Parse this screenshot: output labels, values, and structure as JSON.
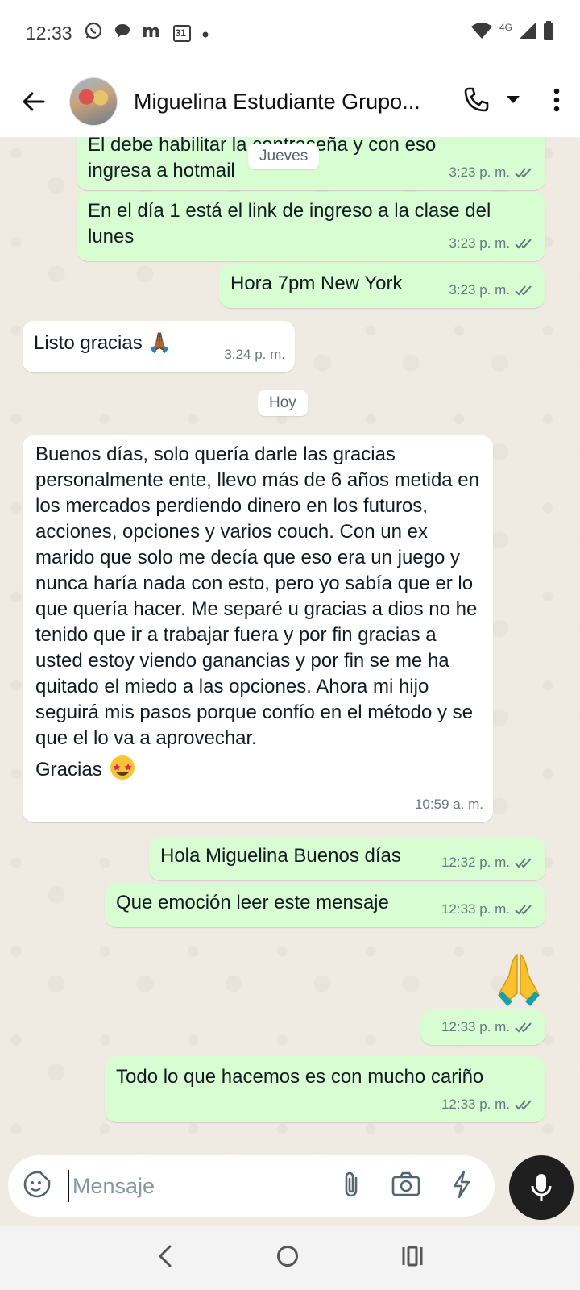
{
  "status_bar": {
    "time": "12:33",
    "network": "4G",
    "icons": [
      "whatsapp-icon",
      "chat-icon",
      "m-app-icon",
      "calendar-icon",
      "dot-icon",
      "wifi-icon",
      "signal-icon",
      "battery-icon"
    ],
    "calendar_day": "31"
  },
  "header": {
    "contact_name": "Miguelina Estudiante Grupo..."
  },
  "messages": [
    {
      "type": "out",
      "text": "El debe habilitar la contraseña y con eso ingresa a hotmail",
      "time": "3:23 p. m."
    },
    {
      "type": "out",
      "text": "En el día 1 está el link de ingreso a la clase del lunes",
      "time": "3:23 p. m."
    },
    {
      "type": "out",
      "text": "Hora 7pm New York",
      "time": "3:23 p. m."
    },
    {
      "type": "in",
      "text": "Listo gracias 🙏🏾",
      "time": "3:24 p. m."
    },
    {
      "type": "in",
      "text": "Buenos días, solo quería darle las gracias personalmente ente, llevo más de 6 años metida en los mercados perdiendo dinero en los futuros, acciones, opciones y varios couch. Con un ex marido que solo me decía que eso era un juego y nunca haría nada con esto, pero yo sabía que er lo que quería hacer. Me separé u gracias a dios no he tenido que ir a trabajar fuera y por fin gracias a usted estoy viendo ganancias y por fin se me ha quitado el miedo a las opciones. Ahora mi hijo seguirá mis pasos porque confío en el método y se que el lo va a aprovechar.",
      "last_line": "Gracias",
      "time": "10:59 a. m."
    },
    {
      "type": "out",
      "text": "Hola Miguelina Buenos días",
      "time": "12:32 p. m."
    },
    {
      "type": "out",
      "text": "Que emoción leer este mensaje",
      "time": "12:33 p. m."
    },
    {
      "type": "out",
      "text": "🙏",
      "time": "12:33 p. m."
    },
    {
      "type": "out",
      "text": "Todo lo que hacemos es con mucho cariño",
      "time": "12:33 p. m."
    }
  ],
  "date_chips": {
    "first": "Jueves",
    "second": "Hoy"
  },
  "input": {
    "placeholder": "Mensaje"
  },
  "colors": {
    "outgoing_bubble": "#d9fdd3",
    "incoming_bubble": "#ffffff",
    "chat_background": "#efeae2",
    "tick_color": "#667781",
    "mic_button": "#1f1f1f"
  }
}
